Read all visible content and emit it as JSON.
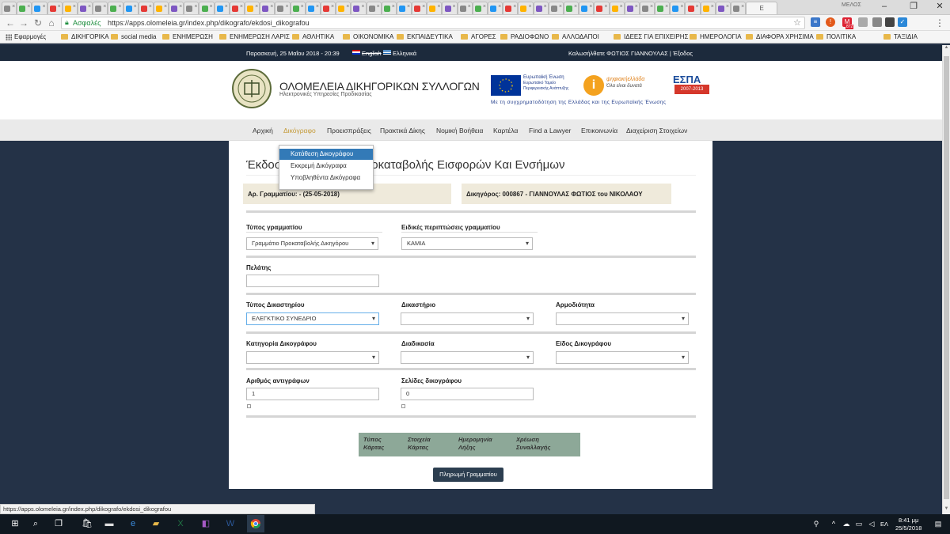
{
  "browser": {
    "tab_count": 49,
    "active_tab_label": "E",
    "secure_label": "Ασφαλές",
    "url": "https://apps.olomeleia.gr/index.php/dikografo/ekdosi_dikografou",
    "profile_label": "ΜΕΛΟΣ",
    "bookmarks": [
      "Εφαρμογές",
      "ΔΙΚΗΓΟΡΙΚΑ",
      "social media",
      "ΕΝΗΜΕΡΩΣΗ",
      "ΕΝΗΜΕΡΩΣΗ ΛΑΡΙΣ",
      "ΑΘΛΗΤΙΚΑ",
      "ΟΙΚΟΝΟΜΙΚΑ",
      "ΕΚΠΑΙΔΕΥΤΙΚΑ",
      "ΑΓΟΡΕΣ",
      "ΡΑΔΙΟΦΩΝΟ",
      "ΑΛΛΟΔΑΠΟΙ",
      "ΙΔΕΕΣ ΓΙΑ ΕΠΙΧΕΙΡΗΣ",
      "ΗΜΕΡΟΛΟΓΙΑ",
      "ΔΙΑΦΟΡΑ ΧΡΗΣΙΜΑ",
      "ΠΟΛΙΤΙΚΑ",
      "ΤΑΞΙΔΙΑ"
    ],
    "mail_badge": "872",
    "status_url": "https://apps.olomeleia.gr/index.php/dikografo/ekdosi_dikografou"
  },
  "site_top": {
    "datetime": "Παρασκευή, 25 Μαΐου 2018 - 20:39",
    "lang_en": "English",
    "lang_gr": "Ελληνικά",
    "welcome": "Καλωσήλθατε ΦΩΤΙΟΣ ΓΙΑΝΝΟΥΛΑΣ | Έξοδος"
  },
  "header": {
    "title": "ΟΛΟΜΕΛΕΙΑ ΔΙΚΗΓΟΡΙΚΩΝ ΣΥΛΛΟΓΩΝ",
    "subtitle": "Ηλεκτρονικές Υπηρεσίες Προδικασίας",
    "eu_text1": "Ευρωπαϊκή Ένωση",
    "eu_text2": "Ευρωπαϊκό Ταμείο Περιφερειακής Ανάπτυξης",
    "digital_label": "ψηφιακήελλάδα",
    "digital_sub": "Όλα είναι δυνατά",
    "espa_label": "ΕΣΠΑ",
    "espa_years": "2007-2013",
    "funding": "Με τη συγχρηματοδότηση της Ελλάδας και της Ευρωπαϊκής Ένωσης"
  },
  "nav": {
    "items": [
      "Αρχική",
      "Δικόγραφο",
      "Προεισπράξεις",
      "Πρακτικά Δίκης",
      "Νομική Βοήθεια",
      "Καρτέλα",
      "Find a Lawyer",
      "Επικοινωνία",
      "Διαχείριση Στοιχείων"
    ],
    "active": "Δικόγραφο",
    "dropdown": [
      "Κατάθεση Δικογράφου",
      "Εκκρεμή Δικόγραφα",
      "Υποβληθέντα Δικόγραφα"
    ]
  },
  "page": {
    "title": "Έκδοση Γραμματίου Προκαταβολής Εισφορών Και Ενσήμων",
    "receipt_no": "Αρ. Γραμματίου: -   (25-05-2018)",
    "lawyer": "Δικηγόρος: 000867 - ΓΙΑΝΝΟΥΛΑΣ ΦΩΤΙΟΣ του ΝΙΚΟΛΑΟΥ"
  },
  "form": {
    "receipt_type_label": "Τύπος γραμματίου",
    "receipt_type_value": "Γραμμάτιο Προκαταβολής Δικηγόρου",
    "special_cases_label": "Ειδικές περιπτώσεις γραμματίου",
    "special_cases_value": "ΚΑΜΙΑ",
    "client_label": "Πελάτης",
    "client_value": "",
    "court_type_label": "Τύπος Δικαστηρίου",
    "court_type_value": "ΕΛΕΓΚΤΙΚΟ ΣΥΝΕΔΡΙΟ",
    "court_label": "Δικαστήριο",
    "jurisdiction_label": "Αρμοδιότητα",
    "category_label": "Κατηγορία Δικογράφου",
    "procedure_label": "Διαδικασία",
    "doc_kind_label": "Είδος Δικογράφου",
    "copies_label": "Αριθμός αντιγράφων",
    "copies_value": "1",
    "pages_label": "Σελίδες δικογράφου",
    "pages_value": "0"
  },
  "card_table": {
    "headers": [
      "Τύπος Κάρτας",
      "Στοιχεία Κάρτας",
      "Ημερομηνία Λήξης",
      "Χρέωση Συναλλαγής"
    ]
  },
  "pay_button": "Πληρωμή Γραμματίου",
  "taskbar": {
    "time": "8:41 μμ",
    "date": "25/5/2018",
    "lang": "ΕΛ"
  }
}
